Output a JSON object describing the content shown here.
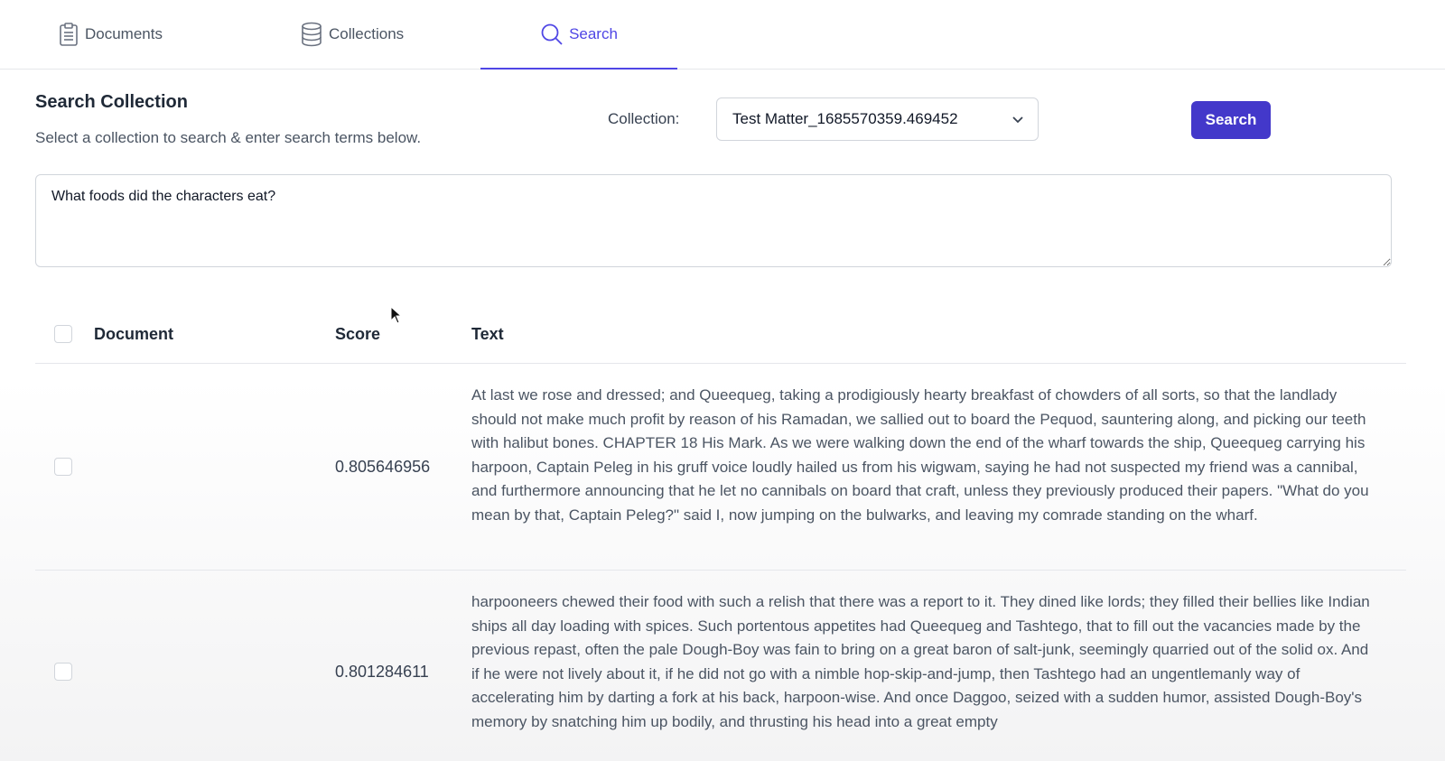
{
  "tabs": [
    {
      "label": "Documents",
      "icon": "clipboard-icon",
      "active": false
    },
    {
      "label": "Collections",
      "icon": "database-icon",
      "active": false
    },
    {
      "label": "Search",
      "icon": "search-icon",
      "active": true
    }
  ],
  "header": {
    "title": "Search Collection",
    "subtitle": "Select a collection to search & enter search terms below.",
    "collection_label": "Collection:",
    "collection_value": "Test Matter_1685570359.469452",
    "search_button_label": "Search"
  },
  "query": {
    "value": "What foods did the characters eat?"
  },
  "table": {
    "columns": [
      "Document",
      "Score",
      "Text"
    ],
    "rows": [
      {
        "document": "",
        "score": "0.805646956",
        "text": "At last we rose and dressed; and Queequeg, taking a prodigiously hearty breakfast of chowders of all sorts, so that the landlady should not make much profit by reason of his Ramadan, we sallied out to board the Pequod, sauntering along, and picking our teeth with halibut bones. CHAPTER 18 His Mark. As we were walking down the end of the wharf towards the ship, Queequeg carrying his harpoon, Captain Peleg in his gruff voice loudly hailed us from his wigwam, saying he had not suspected my friend was a cannibal, and furthermore announcing that he let no cannibals on board that craft, unless they previously produced their papers. \"What do you mean by that, Captain Peleg?\" said I, now jumping on the bulwarks, and leaving my comrade standing on the wharf."
      },
      {
        "document": "",
        "score": "0.801284611",
        "text": "harpooneers chewed their food with such a relish that there was a report to it. They dined like lords; they filled their bellies like Indian ships all day loading with spices. Such portentous appetites had Queequeg and Tashtego, that to fill out the vacancies made by the previous repast, often the pale Dough-Boy was fain to bring on a great baron of salt-junk, seemingly quarried out of the solid ox. And if he were not lively about it, if he did not go with a nimble hop-skip-and-jump, then Tashtego had an ungentlemanly way of accelerating him by darting a fork at his back, harpoon-wise. And once Daggoo, seized with a sudden humor, assisted Dough-Boy's memory by snatching him up bodily, and thrusting his head into a great empty"
      }
    ]
  },
  "colors": {
    "accent": "#4f46e5",
    "button": "#4338ca",
    "border": "#d1d5db"
  }
}
